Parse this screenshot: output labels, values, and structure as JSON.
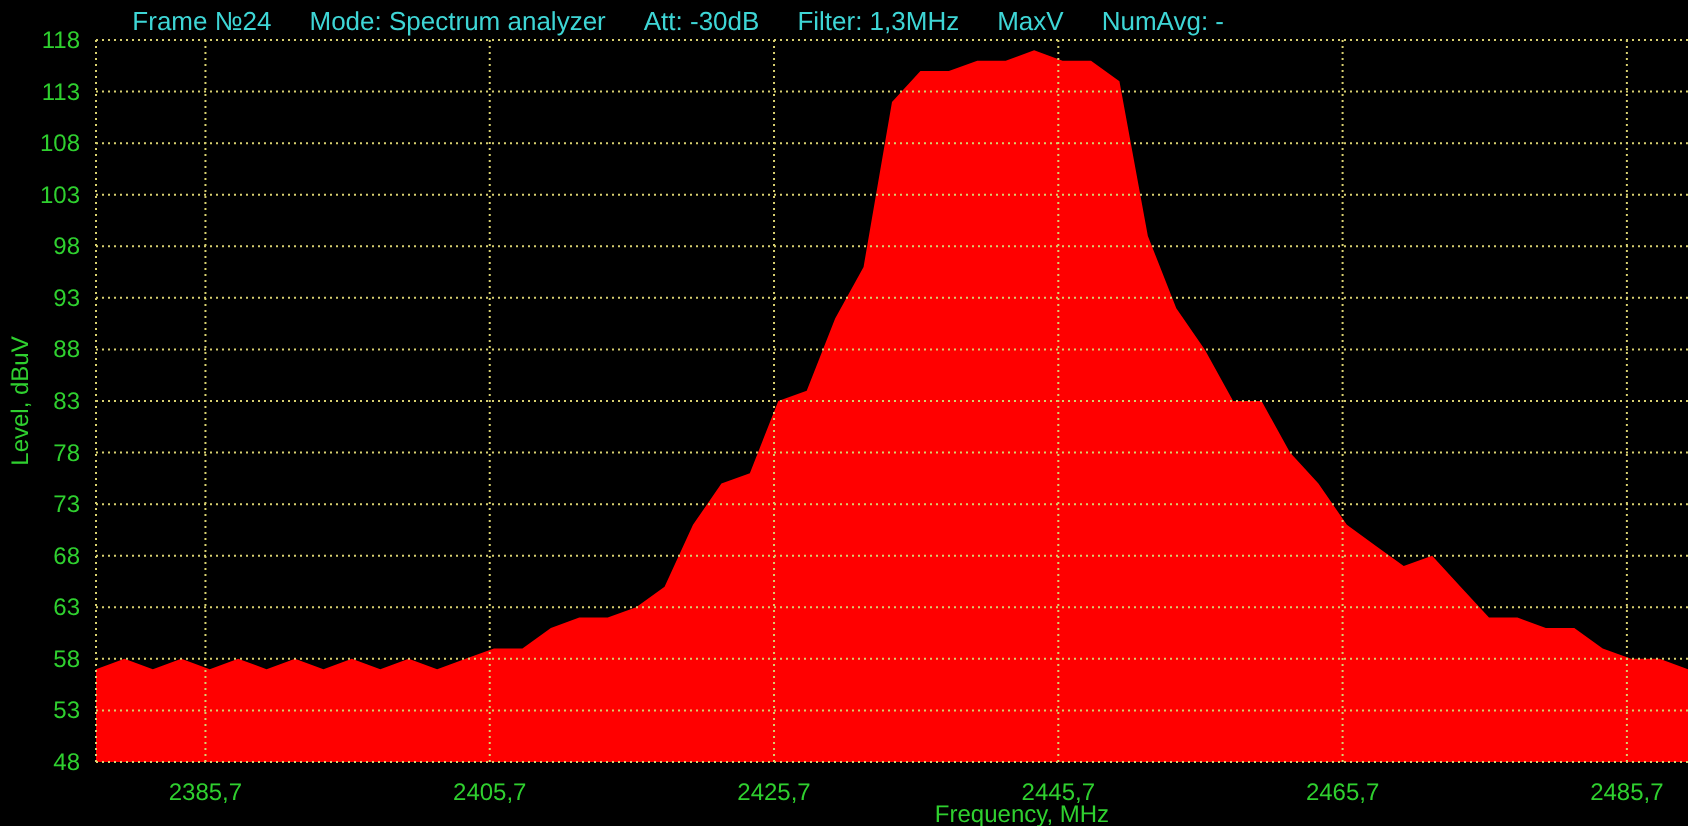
{
  "header": [
    "Frame №24",
    "Mode: Spectrum analyzer",
    "Att: -30dB",
    "Filter: 1,3MHz",
    "MaxV",
    "NumAvg: -"
  ],
  "chart_data": {
    "type": "area",
    "xlabel": "Frequency, MHz",
    "ylabel": "Level, dBuV",
    "x": [
      2378,
      2380,
      2382,
      2384,
      2386,
      2388,
      2390,
      2392,
      2394,
      2396,
      2398,
      2400,
      2402,
      2404,
      2406,
      2408,
      2410,
      2412,
      2414,
      2416,
      2418,
      2420,
      2422,
      2424,
      2426,
      2428,
      2430,
      2432,
      2434,
      2436,
      2438,
      2440,
      2442,
      2444,
      2446,
      2448,
      2450,
      2452,
      2454,
      2456,
      2458,
      2460,
      2462,
      2464,
      2466,
      2468,
      2470,
      2472,
      2474,
      2476,
      2478,
      2480,
      2482,
      2484,
      2486,
      2488,
      2490
    ],
    "grid": true,
    "series": [
      {
        "color": "#ff0000",
        "values": [
          57,
          58,
          57,
          58,
          57,
          58,
          57,
          58,
          57,
          58,
          57,
          58,
          57,
          58,
          59,
          59,
          61,
          62,
          62,
          63,
          65,
          71,
          75,
          76,
          83,
          84,
          91,
          96,
          112,
          115,
          115,
          116,
          116,
          117,
          116,
          116,
          114,
          99,
          92,
          88,
          83,
          83,
          78,
          75,
          71,
          69,
          67,
          68,
          65,
          62,
          62,
          61,
          61,
          59,
          58,
          58,
          57
        ]
      }
    ],
    "xlim": [
      2378,
      2490
    ],
    "ylim": [
      48,
      118
    ],
    "xticks": [
      {
        "value": 2385.7,
        "label": "2385,7"
      },
      {
        "value": 2405.7,
        "label": "2405,7"
      },
      {
        "value": 2425.7,
        "label": "2425,7"
      },
      {
        "value": 2445.7,
        "label": "2445,7"
      },
      {
        "value": 2465.7,
        "label": "2465,7"
      },
      {
        "value": 2485.7,
        "label": "2485,7"
      }
    ],
    "yticks": [
      48,
      53,
      58,
      63,
      68,
      73,
      78,
      83,
      88,
      93,
      98,
      103,
      108,
      113,
      118
    ]
  }
}
